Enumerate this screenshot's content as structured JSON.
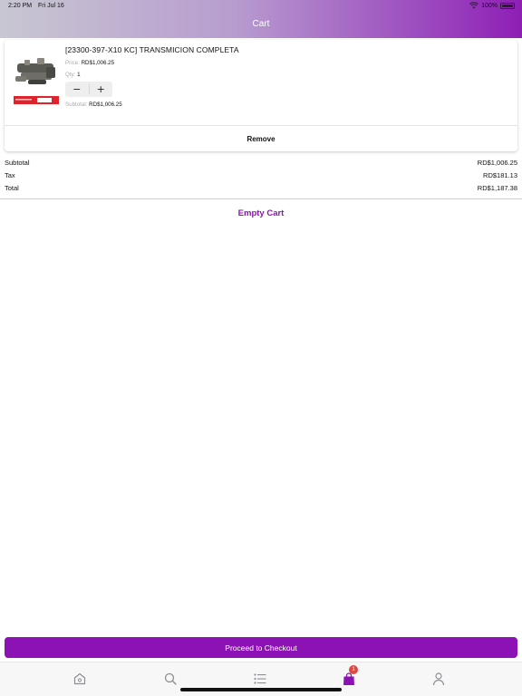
{
  "status_bar": {
    "time": "2:20 PM",
    "date": "Fri Jul 16",
    "battery": "100%"
  },
  "header": {
    "title": "Cart"
  },
  "cart_item": {
    "name": "[23300-397-X10 KC]  TRANSMICION COMPLETA",
    "price_label": "Price:",
    "price": "RD$1,006.25",
    "qty_label": "Qty:",
    "qty": "1",
    "subtotal_label": "Subtotal:",
    "subtotal": "RD$1,006.25",
    "decrement": "−",
    "increment": "+",
    "remove_label": "Remove"
  },
  "summary": [
    {
      "label": "Subtotal",
      "value": "RD$1,006.25"
    },
    {
      "label": "Tax",
      "value": "RD$181.13"
    },
    {
      "label": "Total",
      "value": "RD$1,187.38"
    }
  ],
  "empty_cart_label": "Empty Cart",
  "checkout_label": "Proceed to Checkout",
  "tabbar": {
    "items": [
      "home-icon",
      "search-icon",
      "list-icon",
      "bag-icon",
      "person-icon"
    ],
    "cart_badge": "1",
    "active_color": "#8d12b5",
    "inactive_color": "#8e8e93"
  },
  "colors": {
    "accent": "#8d12b5",
    "badge": "#e0483f"
  }
}
